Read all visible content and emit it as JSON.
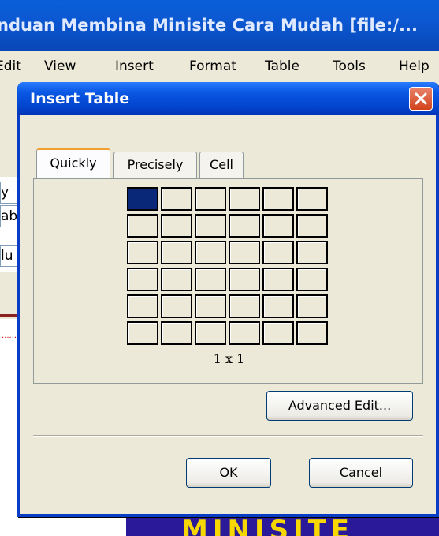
{
  "app": {
    "title": "nduan Membina Minisite Cara Mudah [file:/..."
  },
  "menu": {
    "edit": "Edit",
    "view": "View",
    "insert": "Insert",
    "format": "Format",
    "table": "Table",
    "tools": "Tools",
    "help": "Help"
  },
  "left_fields": [
    "y",
    "ab",
    "lu"
  ],
  "banner_text": "MINISITE",
  "dialog": {
    "title": "Insert Table",
    "tabs": [
      {
        "label": "Quickly",
        "active": true
      },
      {
        "label": "Precisely",
        "active": false
      },
      {
        "label": "Cell",
        "active": false
      }
    ],
    "grid": {
      "rows": 6,
      "cols": 6,
      "selected_rows": 1,
      "selected_cols": 1
    },
    "grid_label": "1 x 1",
    "advanced_button": "Advanced Edit...",
    "ok_button": "OK",
    "cancel_button": "Cancel"
  },
  "colors": {
    "titlebar": "#0346d0",
    "selection": "#0a2878",
    "close": "#d2421b"
  }
}
